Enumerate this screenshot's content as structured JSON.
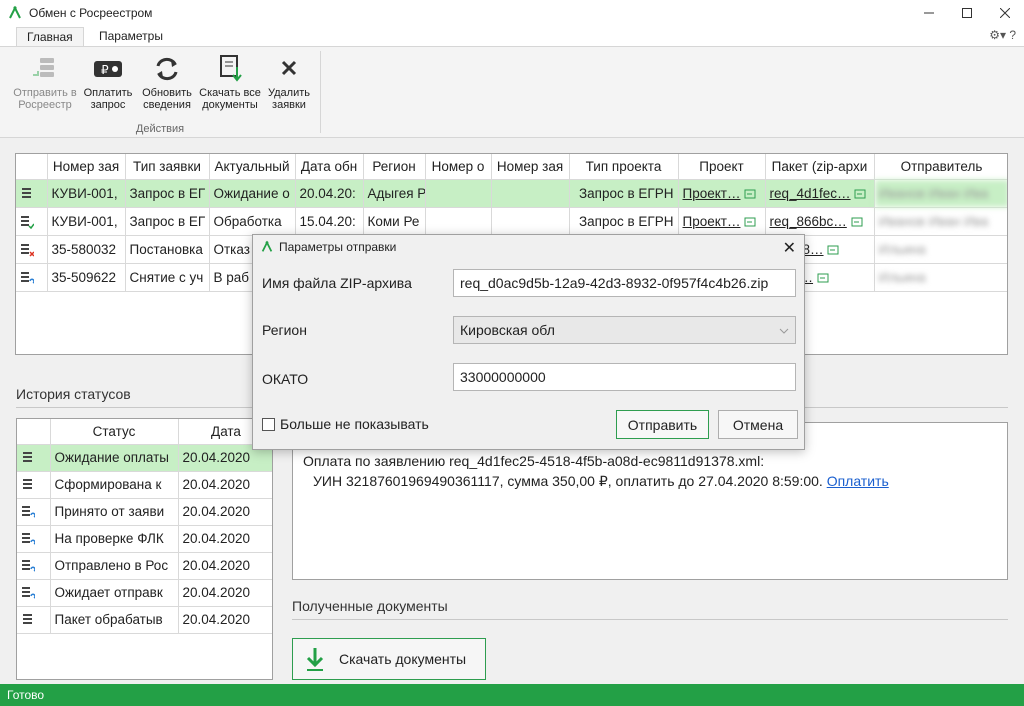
{
  "window": {
    "title": "Обмен с Росреестром"
  },
  "tabs": [
    {
      "label": "Главная",
      "active": true
    },
    {
      "label": "Параметры",
      "active": false
    }
  ],
  "tab_right": "⚙▾ ?",
  "ribbon": {
    "buttons": [
      {
        "line1": "Отправить в",
        "line2": "Росреестр",
        "icon": "send-stack-icon",
        "disabled": true
      },
      {
        "line1": "Оплатить",
        "line2": "запрос",
        "icon": "ruble-card-icon",
        "disabled": false
      },
      {
        "line1": "Обновить",
        "line2": "сведения",
        "icon": "refresh-icon",
        "disabled": false
      },
      {
        "line1": "Скачать все",
        "line2": "документы",
        "icon": "download-docs-icon",
        "disabled": false
      },
      {
        "line1": "Удалить",
        "line2": "заявки",
        "icon": "delete-x-icon",
        "disabled": false
      }
    ],
    "group_label": "Действия"
  },
  "requests_table": {
    "columns": [
      "",
      "Номер зая",
      "Тип заявки",
      "Актуальный",
      "Дата обн",
      "Регион",
      "Номер о",
      "Номер зая",
      "Тип проекта",
      "Проект",
      "Пакет (zip-архи",
      "Отправитель"
    ],
    "rows": [
      {
        "icon": "status-doc-icon",
        "num": "КУВИ-001,",
        "type": "Запрос в ЕГ",
        "actual": "Ожидание о",
        "date": "20.04.20:",
        "region": "Адыгея Р",
        "num_o": "",
        "num_z": "",
        "project_type": "Запрос в ЕГРН",
        "project": "Проект…",
        "package": "req_4d1fec…",
        "sender": "Иванов Иван Ива"
      },
      {
        "icon": "status-check-icon",
        "num": "КУВИ-001,",
        "type": "Запрос в ЕГ",
        "actual": "Обработка",
        "date": "15.04.20:",
        "region": "Коми Ре",
        "num_o": "",
        "num_z": "",
        "project_type": "Запрос в ЕГРН",
        "project": "Проект…",
        "package": "req_866bc…",
        "sender": "Иванов Иван Ива"
      },
      {
        "icon": "status-error-icon",
        "num": "35-580032",
        "type": "Постановка",
        "actual": "Отказ",
        "date": "",
        "region": "",
        "num_o": "",
        "num_z": "",
        "project_type": "",
        "project": "",
        "package": "ZU_38…",
        "sender": "Ильина"
      },
      {
        "icon": "status-sync-icon",
        "num": "35-509622",
        "type": "Снятие с уч",
        "actual": "В раб",
        "date": "",
        "region": "",
        "num_o": "",
        "num_z": "",
        "project_type": "",
        "project": "",
        "package": "a280…",
        "sender": "Ильина"
      }
    ]
  },
  "history": {
    "title": "История статусов",
    "columns": [
      "",
      "Статус",
      "Дата"
    ],
    "rows": [
      {
        "icon": "status-doc-icon",
        "status": "Ожидание оплаты",
        "date": "20.04.2020"
      },
      {
        "icon": "status-doc-icon",
        "status": "Сформирована к",
        "date": "20.04.2020"
      },
      {
        "icon": "status-sync-icon",
        "status": "Принято от заяви",
        "date": "20.04.2020"
      },
      {
        "icon": "status-sync-icon",
        "status": "На проверке ФЛК",
        "date": "20.04.2020"
      },
      {
        "icon": "status-sync-icon",
        "status": "Отправлено в Рос",
        "date": "20.04.2020"
      },
      {
        "icon": "status-sync-icon",
        "status": "Ожидает отправк",
        "date": "20.04.2020"
      },
      {
        "icon": "status-doc-icon",
        "status": "Пакет обрабатыв",
        "date": "20.04.2020"
      }
    ]
  },
  "info": {
    "line1": "Оплата по заявлению req_4d1fec25-4518-4f5b-a08d-ec9811d91378.xml:",
    "line2": "УИН 32187601969490361117, сумма 350,00 ₽, оплатить до 27.04.2020 8:59:00.",
    "pay_link": "Оплатить"
  },
  "received_docs": {
    "title": "Полученные документы",
    "download_button": "Скачать документы"
  },
  "status_bar": "Готово",
  "dialog": {
    "title": "Параметры отправки",
    "zip_label": "Имя файла ZIP-архива",
    "zip_value": "req_d0ac9d5b-12a9-42d3-8932-0f957f4c4b26.zip",
    "region_label": "Регион",
    "region_value": "Кировская обл",
    "okato_label": "ОКАТО",
    "okato_value": "33000000000",
    "dont_show": "Больше не показывать",
    "send_button": "Отправить",
    "cancel_button": "Отмена"
  },
  "colors": {
    "accent": "#23a046",
    "selection": "#c7efc5",
    "link": "#1a5fcf"
  }
}
